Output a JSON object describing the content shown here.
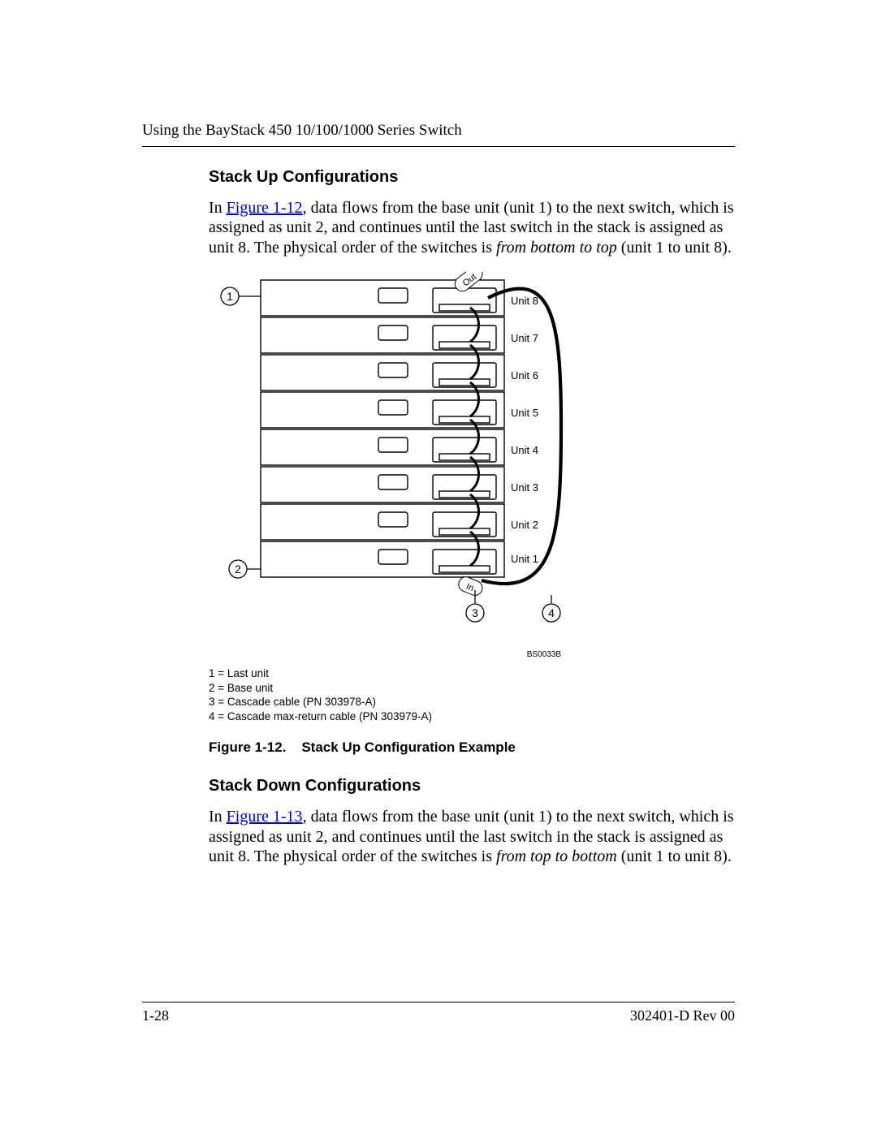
{
  "header": {
    "running": "Using the BayStack 450 10/100/1000 Series Switch"
  },
  "sections": {
    "up": {
      "heading": "Stack Up Configurations",
      "para_pre": "In ",
      "figlink": "Figure 1-12",
      "para_post1": ", data flows from the base unit (unit 1) to the next switch, which is assigned as unit 2, and continues until the last switch in the stack is assigned as unit 8. The physical order of the switches is ",
      "em": "from bottom to top",
      "para_post2": " (unit 1 to unit 8)."
    },
    "down": {
      "heading": "Stack Down Configurations",
      "para_pre": "In ",
      "figlink": "Figure 1-13",
      "para_post1": ", data flows from the base unit (unit 1) to the next switch, which is assigned as unit 2, and continues until the last switch in the stack is assigned as unit 8. The physical order of the switches is ",
      "em": "from top to bottom",
      "para_post2": " (unit 1 to unit 8)."
    }
  },
  "figure": {
    "caption_label": "Figure 1-12.",
    "caption_title": "Stack Up Configuration Example",
    "code": "BS0033B",
    "units": [
      "Unit 8",
      "Unit 7",
      "Unit 6",
      "Unit 5",
      "Unit 4",
      "Unit 3",
      "Unit 2",
      "Unit 1"
    ],
    "callouts": {
      "c1": "1",
      "c2": "2",
      "c3": "3",
      "c4": "4"
    },
    "flow_out": "Out",
    "flow_in": "In",
    "legend": {
      "l1": "1 = Last unit",
      "l2": "2 = Base unit",
      "l3": "3 = Cascade cable (PN 303978-A)",
      "l4": "4 = Cascade max-return cable (PN 303979-A)"
    }
  },
  "footer": {
    "page": "1-28",
    "rev": "302401-D Rev 00"
  }
}
